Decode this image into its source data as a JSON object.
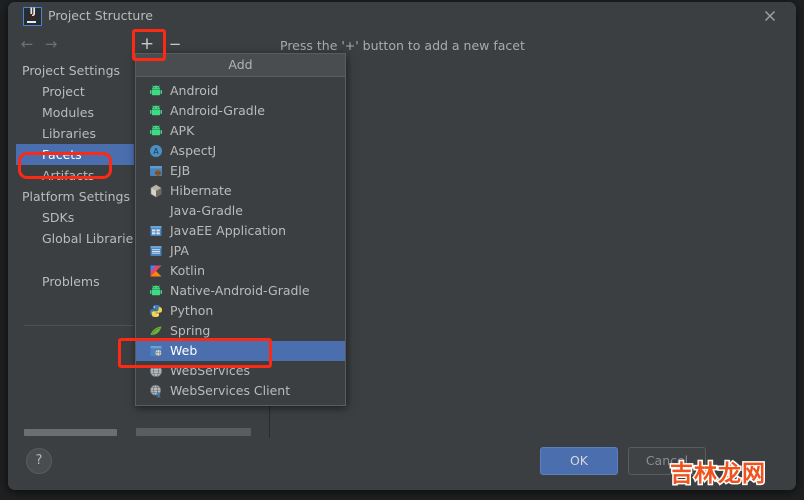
{
  "window": {
    "title": "Project Structure",
    "logo_text": "IJ",
    "close_icon": "close-icon"
  },
  "toolbar": {
    "back_icon": "arrow-left-icon",
    "forward_icon": "arrow-right-icon",
    "add_label": "+",
    "remove_label": "−",
    "hint": "Press the '+' button to add a new facet"
  },
  "sidebar": {
    "items": [
      {
        "label": "Project Settings",
        "type": "group",
        "selected": false
      },
      {
        "label": "Project",
        "type": "child",
        "selected": false
      },
      {
        "label": "Modules",
        "type": "child",
        "selected": false
      },
      {
        "label": "Libraries",
        "type": "child",
        "selected": false
      },
      {
        "label": "Facets",
        "type": "child",
        "selected": true
      },
      {
        "label": "Artifacts",
        "type": "child",
        "selected": false
      },
      {
        "label": "Platform Settings",
        "type": "group",
        "selected": false
      },
      {
        "label": "SDKs",
        "type": "child",
        "selected": false
      },
      {
        "label": "Global Librarie",
        "type": "child",
        "selected": false
      },
      {
        "label": "Problems",
        "type": "child",
        "selected": false
      }
    ]
  },
  "add_menu": {
    "header": "Add",
    "items": [
      {
        "label": "Android",
        "icon": "android-icon",
        "selected": false
      },
      {
        "label": "Android-Gradle",
        "icon": "android-icon",
        "selected": false
      },
      {
        "label": "APK",
        "icon": "android-icon",
        "selected": false
      },
      {
        "label": "AspectJ",
        "icon": "aspectj-icon",
        "selected": false
      },
      {
        "label": "EJB",
        "icon": "ejb-icon",
        "selected": false
      },
      {
        "label": "Hibernate",
        "icon": "hibernate-icon",
        "selected": false
      },
      {
        "label": "Java-Gradle",
        "icon": "none-icon",
        "selected": false
      },
      {
        "label": "JavaEE Application",
        "icon": "javaee-icon",
        "selected": false
      },
      {
        "label": "JPA",
        "icon": "jpa-icon",
        "selected": false
      },
      {
        "label": "Kotlin",
        "icon": "kotlin-icon",
        "selected": false
      },
      {
        "label": "Native-Android-Gradle",
        "icon": "android-icon",
        "selected": false
      },
      {
        "label": "Python",
        "icon": "python-icon",
        "selected": false
      },
      {
        "label": "Spring",
        "icon": "spring-icon",
        "selected": false
      },
      {
        "label": "Web",
        "icon": "web-icon",
        "selected": true
      },
      {
        "label": "WebServices",
        "icon": "webservices-icon",
        "selected": false
      },
      {
        "label": "WebServices Client",
        "icon": "webservices-client-icon",
        "selected": false
      }
    ]
  },
  "buttons": {
    "help": "?",
    "ok": "OK",
    "cancel": "Cancel"
  },
  "watermark": {
    "text": "吉林龙网"
  },
  "colors": {
    "dialog_background": "#3c3f41",
    "selection_blue": "#4b6eaf",
    "annotation_red": "#fc2a14",
    "text_primary": "#bbbbbb",
    "watermark_orange": "#f0531c"
  }
}
